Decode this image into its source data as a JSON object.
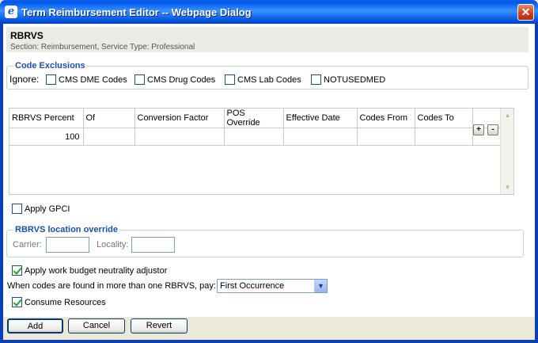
{
  "window": {
    "title": "Term Reimbursement Editor -- Webpage Dialog",
    "close_label": "✕",
    "icon_glyph": "e"
  },
  "header": {
    "title": "RBRVS",
    "subtitle": "Section: Reimbursement, Service Type: Professional"
  },
  "code_exclusions": {
    "legend": "Code Exclusions",
    "ignore_label": "Ignore:",
    "options": [
      {
        "label": "CMS DME Codes",
        "checked": false
      },
      {
        "label": "CMS Drug Codes",
        "checked": false
      },
      {
        "label": "CMS Lab Codes",
        "checked": false
      },
      {
        "label": "NOTUSEDMED",
        "checked": false
      }
    ]
  },
  "grid": {
    "columns": [
      "RBRVS Percent",
      "Of",
      "Conversion Factor",
      "POS Override",
      "Effective Date",
      "Codes From",
      "Codes To"
    ],
    "rows": [
      [
        "100",
        "",
        "",
        "",
        "",
        "",
        ""
      ]
    ],
    "add_label": "+",
    "remove_label": "-"
  },
  "apply_gpci": {
    "label": "Apply GPCI",
    "checked": false
  },
  "location_override": {
    "legend": "RBRVS location override",
    "carrier_label": "Carrier:",
    "carrier_value": "",
    "locality_label": "Locality:",
    "locality_value": ""
  },
  "budget_neutrality": {
    "label": "Apply work budget neutrality adjustor",
    "checked": true
  },
  "pay_rule": {
    "label": "When codes are found in more than one RBRVS, pay:",
    "selected": "First Occurrence"
  },
  "consume_resources": {
    "label": "Consume Resources",
    "checked": true
  },
  "buttons": {
    "add": "Add",
    "cancel": "Cancel",
    "revert": "Revert"
  }
}
